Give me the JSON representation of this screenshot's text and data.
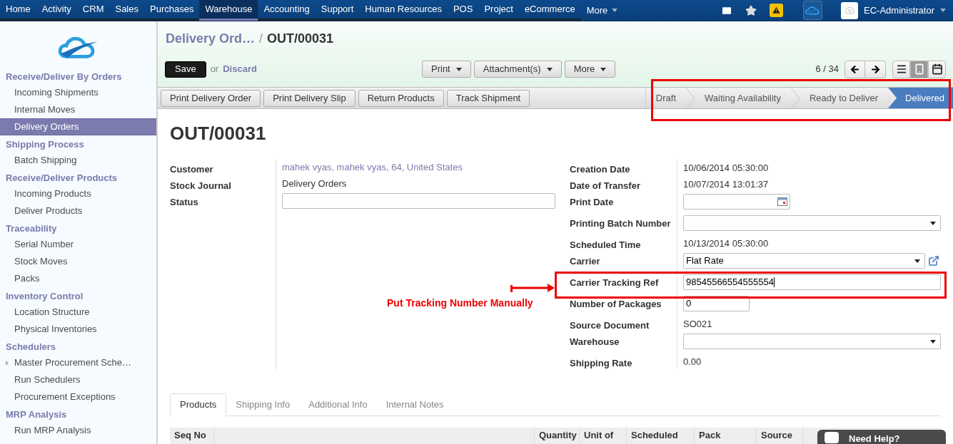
{
  "nav": {
    "items": [
      {
        "label": "Home",
        "selected": false
      },
      {
        "label": "Activity",
        "selected": false
      },
      {
        "label": "CRM",
        "selected": false
      },
      {
        "label": "Sales",
        "selected": false
      },
      {
        "label": "Purchases",
        "selected": false
      },
      {
        "label": "Warehouse",
        "selected": true
      },
      {
        "label": "Accounting",
        "selected": false
      },
      {
        "label": "Support",
        "selected": false
      },
      {
        "label": "Human Resources",
        "selected": false
      },
      {
        "label": "POS",
        "selected": false
      },
      {
        "label": "Project",
        "selected": false
      },
      {
        "label": "eCommerce",
        "selected": false
      }
    ],
    "more": "More",
    "user": "EC-Administrator"
  },
  "sidebar": {
    "sections": [
      {
        "title": "Receive/Deliver By Orders",
        "items": [
          {
            "label": "Incoming Shipments",
            "selected": false
          },
          {
            "label": "Internal Moves",
            "selected": false
          },
          {
            "label": "Delivery Orders",
            "selected": true
          }
        ]
      },
      {
        "title": "Shipping Process",
        "items": [
          {
            "label": "Batch Shipping",
            "selected": false
          }
        ]
      },
      {
        "title": "Receive/Deliver Products",
        "items": [
          {
            "label": "Incoming Products",
            "selected": false
          },
          {
            "label": "Deliver Products",
            "selected": false
          }
        ]
      },
      {
        "title": "Traceability",
        "items": [
          {
            "label": "Serial Number",
            "selected": false
          },
          {
            "label": "Stock Moves",
            "selected": false
          },
          {
            "label": "Packs",
            "selected": false
          }
        ]
      },
      {
        "title": "Inventory Control",
        "items": [
          {
            "label": "Location Structure",
            "selected": false
          },
          {
            "label": "Physical Inventories",
            "selected": false
          }
        ]
      },
      {
        "title": "Schedulers",
        "items": [
          {
            "label": "Master Procurement Sche…",
            "selected": false,
            "expandable": true
          },
          {
            "label": "Run Schedulers",
            "selected": false
          },
          {
            "label": "Procurement Exceptions",
            "selected": false
          }
        ]
      },
      {
        "title": "MRP Analysis",
        "items": [
          {
            "label": "Run MRP Analysis",
            "selected": false
          }
        ]
      }
    ]
  },
  "breadcrumb": {
    "parent": "Delivery Ord…",
    "separator": "/",
    "current": "OUT/00031"
  },
  "toolbar": {
    "save": "Save",
    "or": "or",
    "discard": "Discard",
    "menus": [
      "Print",
      "Attachment(s)",
      "More"
    ],
    "pager": "6 / 34",
    "views": [
      {
        "kind": "list",
        "selected": false
      },
      {
        "kind": "form",
        "selected": true
      },
      {
        "kind": "calendar",
        "selected": false
      }
    ]
  },
  "actions": [
    "Print Delivery Order",
    "Print Delivery Slip",
    "Return Products",
    "Track Shipment"
  ],
  "statusbar": [
    {
      "label": "Draft",
      "selected": false
    },
    {
      "label": "Waiting Availability",
      "selected": false
    },
    {
      "label": "Ready to Deliver",
      "selected": false
    },
    {
      "label": "Delivered",
      "selected": true
    }
  ],
  "form": {
    "title": "OUT/00031",
    "left": [
      {
        "label": "Customer",
        "kind": "link",
        "value": "mahek vyas, mahek vyas, 64, United States"
      },
      {
        "label": "Stock Journal",
        "kind": "text",
        "value": "Delivery Orders"
      },
      {
        "label": "Status",
        "kind": "input"
      }
    ],
    "right": [
      {
        "label": "Creation Date",
        "kind": "text",
        "value": "10/06/2014 05:30:00"
      },
      {
        "label": "Date of Transfer",
        "kind": "text",
        "value": "10/07/2014 13:01:37"
      },
      {
        "label": "Print Date",
        "kind": "date"
      },
      {
        "label": "Printing Batch Number",
        "kind": "select"
      },
      {
        "label": "Scheduled Time",
        "kind": "text",
        "value": "10/13/2014 05:30:00"
      },
      {
        "label": "Carrier",
        "kind": "select-link",
        "value": "Flat Rate"
      },
      {
        "label": "Carrier Tracking Ref",
        "kind": "input-wide",
        "value": "98545566554555554"
      },
      {
        "label": "Number of Packages",
        "kind": "input",
        "value": "0"
      },
      {
        "label": "Source Document",
        "kind": "text",
        "value": "SO021"
      },
      {
        "label": "Warehouse",
        "kind": "select"
      },
      {
        "label": "Shipping Rate",
        "kind": "text",
        "value": "0.00"
      }
    ]
  },
  "annotation": {
    "text": "Put Tracking Number Manually"
  },
  "tabs": [
    {
      "label": "Products",
      "selected": true
    },
    {
      "label": "Shipping Info",
      "selected": false
    },
    {
      "label": "Additional Info",
      "selected": false
    },
    {
      "label": "Internal Notes",
      "selected": false
    }
  ],
  "table": {
    "columns": [
      "Seq No",
      "",
      "Quantity",
      "Unit of",
      "Scheduled",
      "Pack",
      "Source"
    ]
  },
  "chat": {
    "label": "Need Help?"
  }
}
